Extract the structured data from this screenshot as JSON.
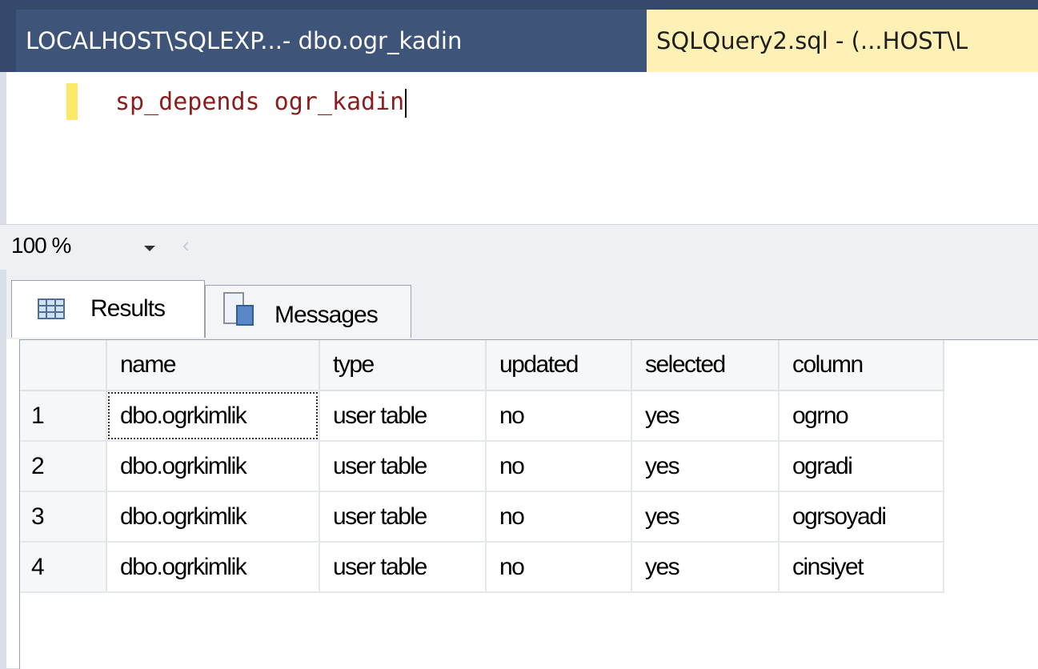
{
  "tabs": [
    {
      "label": "LOCALHOST\\SQLEXP...- dbo.ogr_kadin",
      "active": false
    },
    {
      "label": "SQLQuery2.sql - (...HOST\\L",
      "active": true
    }
  ],
  "editor": {
    "code": "sp_depends ogr_kadin"
  },
  "zoom": {
    "value": "100 %"
  },
  "result_tabs": {
    "results_label": "Results",
    "messages_label": "Messages"
  },
  "grid": {
    "columns": [
      "name",
      "type",
      "updated",
      "selected",
      "column"
    ],
    "rows": [
      {
        "num": "1",
        "cells": [
          "dbo.ogrkimlik",
          "user table",
          "no",
          "yes",
          "ogrno"
        ]
      },
      {
        "num": "2",
        "cells": [
          "dbo.ogrkimlik",
          "user table",
          "no",
          "yes",
          "ogradi"
        ]
      },
      {
        "num": "3",
        "cells": [
          "dbo.ogrkimlik",
          "user table",
          "no",
          "yes",
          "ogrsoyadi"
        ]
      },
      {
        "num": "4",
        "cells": [
          "dbo.ogrkimlik",
          "user table",
          "no",
          "yes",
          "cinsiyet"
        ]
      }
    ]
  },
  "colors": {
    "tab_strip": "#35496b",
    "active_tab": "#fff1b5",
    "code_text": "#8b1d1d",
    "change_bar": "#fde968"
  }
}
